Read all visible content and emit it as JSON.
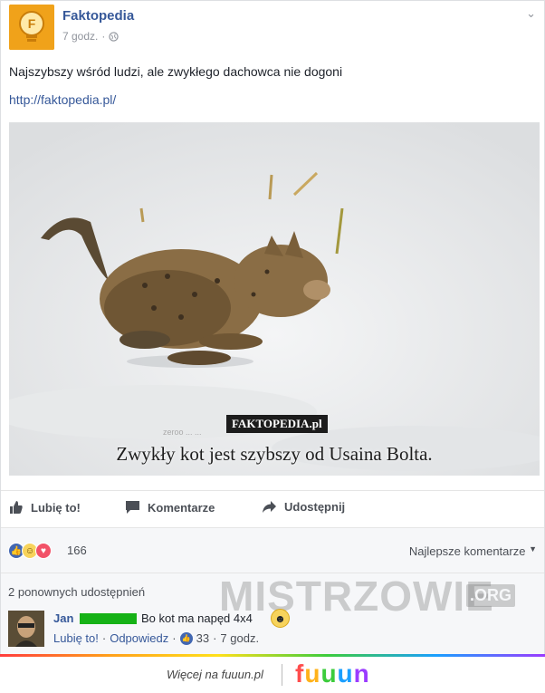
{
  "post": {
    "page_name": "Faktopedia",
    "time": "7 godz.",
    "text": "Najszybszy wśród ludzi, ale zwykłego dachowca nie dogoni",
    "link": "http://faktopedia.pl/",
    "photo": {
      "watermark": "FAKTOPEDIA.pl",
      "caption": "Zwykły kot jest szybszy od Usaina Bolta."
    }
  },
  "actions": {
    "like": "Lubię to!",
    "comment": "Komentarze",
    "share": "Udostępnij"
  },
  "reactions": {
    "count": "166",
    "sort_label": "Najlepsze komentarze"
  },
  "comments": {
    "shares_text": "2 ponownych udostępnień",
    "watermark": "MISTRZOWIE",
    "watermark_suffix": ".ORG",
    "items": [
      {
        "author": "Jan",
        "text": "Bo kot ma napęd 4x4",
        "like": "Lubię to!",
        "reply": "Odpowiedz",
        "likes": "33",
        "time": "7 godz."
      }
    ]
  },
  "footer": {
    "text": "Więcej na fuuun.pl",
    "logo": [
      "f",
      "u",
      "u",
      "u",
      "n"
    ]
  },
  "colors": {
    "link": "#365899",
    "like_blue": "#4267b2",
    "love_red": "#f25268",
    "haha_yellow": "#f7d35c"
  }
}
